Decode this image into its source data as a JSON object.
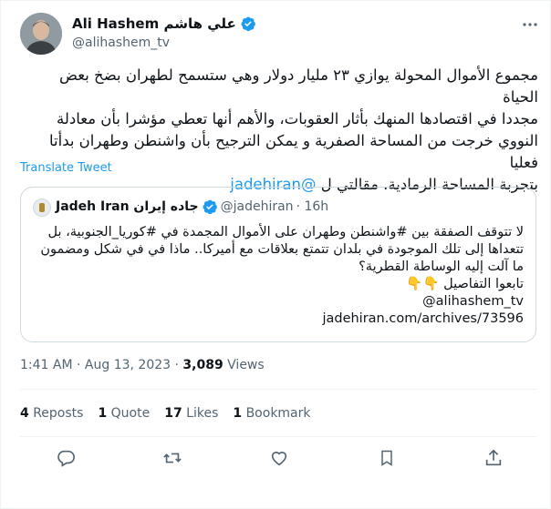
{
  "author": {
    "display_name": "Ali Hashem علي هاشم",
    "handle": "@alihashem_tv",
    "avatar_icon": "user-avatar"
  },
  "tweet": {
    "text_lines": [
      "مجموع الأموال المحولة يوازي ٢٣ مليار دولار وهي ستسمح لطهران بضخ بعض الحياة",
      "مجددا في اقتصادها المنهك بأثار العقوبات، والأهم أنها تعطي مؤشرا بأن معادلة",
      "النووي خرجت من المساحة الصفرية و يمكن الترجيح بأن واشنطن وطهران بدأتا فعليا",
      "بتجربة المساحة الرمادية. مقالتي ل"
    ],
    "mention": "@jadehiran",
    "translate_label": "Translate Tweet"
  },
  "quote": {
    "name": "Jadeh Iran جاده إيران",
    "handle": "@jadehiran",
    "time": "· 16h",
    "lines": [
      "لا تتوقف الصفقة بين #واشنطن وطهران على الأموال المجمدة في #كوريا_الجنوبية، بل",
      "تتعداها إلى تلك الموجودة في بلدان تتمتع بعلاقات مع أميركا.. ماذا في في شكل ومضمون",
      "ما آلت إليه الوساطة القطرية؟",
      "تابعوا التفاصيل 👇👇",
      "@alihashem_tv",
      "jadehiran.com/archives/73596"
    ]
  },
  "meta": {
    "time": "1:41 AM",
    "date": "Aug 13, 2023",
    "views_count": "3,089",
    "views_label": "Views"
  },
  "stats": {
    "reposts_count": "4",
    "reposts_label": "Reposts",
    "quotes_count": "1",
    "quotes_label": "Quote",
    "likes_count": "17",
    "likes_label": "Likes",
    "bookmarks_count": "1",
    "bookmarks_label": "Bookmark"
  },
  "colors": {
    "accent": "#1d9bf0",
    "text": "#0f1419",
    "muted": "#536471",
    "border": "#cfd9de"
  }
}
